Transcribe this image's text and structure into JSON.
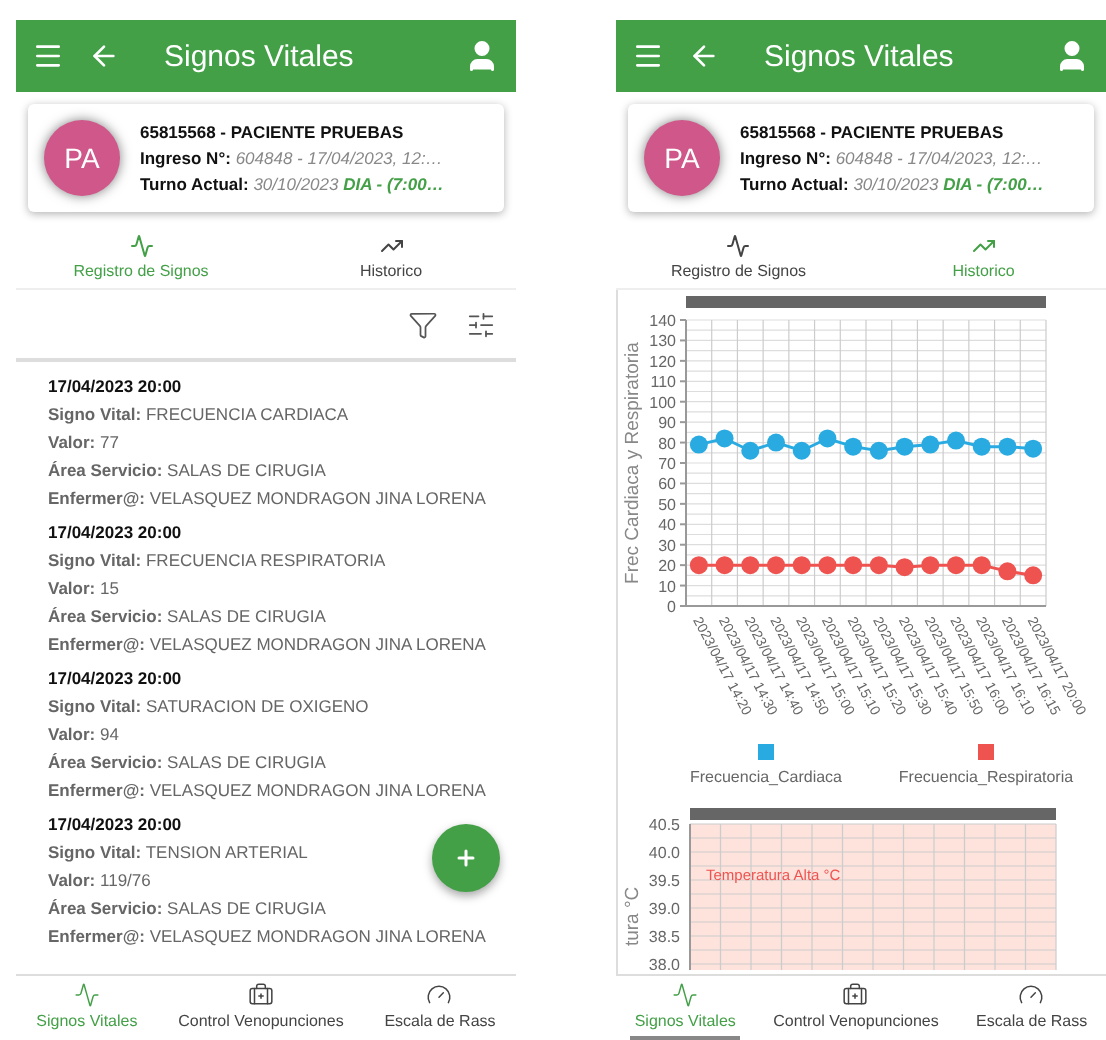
{
  "screens": [
    {
      "header": {
        "title": "Signos Vitales"
      },
      "patient": {
        "initials": "PA",
        "name": "65815568 - PACIENTE PRUEBAS",
        "admission_label": "Ingreso N°:",
        "admission_value": "604848 - 17/04/2023, 12:…",
        "shift_label": "Turno Actual:",
        "shift_date": "30/10/2023",
        "shift_name": "DIA - (7:00…"
      },
      "tabs": [
        {
          "label": "Registro de Signos",
          "selected": true
        },
        {
          "label": "Historico",
          "selected": false
        }
      ],
      "records": [
        {
          "datetime": "17/04/2023 20:00",
          "fields": [
            {
              "label": "Signo Vital:",
              "value": "FRECUENCIA CARDIACA"
            },
            {
              "label": "Valor:",
              "value": "77"
            },
            {
              "label": "Área Servicio:",
              "value": "SALAS DE CIRUGIA"
            },
            {
              "label": "Enfermer@:",
              "value": "VELASQUEZ MONDRAGON JINA LORENA"
            }
          ]
        },
        {
          "datetime": "17/04/2023 20:00",
          "fields": [
            {
              "label": "Signo Vital:",
              "value": "FRECUENCIA RESPIRATORIA"
            },
            {
              "label": "Valor:",
              "value": "15"
            },
            {
              "label": "Área Servicio:",
              "value": "SALAS DE CIRUGIA"
            },
            {
              "label": "Enfermer@:",
              "value": "VELASQUEZ MONDRAGON JINA LORENA"
            }
          ]
        },
        {
          "datetime": "17/04/2023 20:00",
          "fields": [
            {
              "label": "Signo Vital:",
              "value": "SATURACION DE OXIGENO"
            },
            {
              "label": "Valor:",
              "value": "94"
            },
            {
              "label": "Área Servicio:",
              "value": "SALAS DE CIRUGIA"
            },
            {
              "label": "Enfermer@:",
              "value": "VELASQUEZ MONDRAGON JINA LORENA"
            }
          ]
        },
        {
          "datetime": "17/04/2023 20:00",
          "fields": [
            {
              "label": "Signo Vital:",
              "value": "TENSION ARTERIAL"
            },
            {
              "label": "Valor:",
              "value": "119/76"
            },
            {
              "label": "Área Servicio:",
              "value": "SALAS DE CIRUGIA"
            },
            {
              "label": "Enfermer@:",
              "value": "VELASQUEZ MONDRAGON JINA LORENA"
            }
          ]
        }
      ],
      "bottom_nav": [
        {
          "label": "Signos Vitales",
          "selected": true
        },
        {
          "label": "Control Venopunciones",
          "selected": false
        },
        {
          "label": "Escala de Rass",
          "selected": false
        }
      ]
    },
    {
      "header": {
        "title": "Signos Vitales"
      },
      "patient": {
        "initials": "PA",
        "name": "65815568 - PACIENTE PRUEBAS",
        "admission_label": "Ingreso N°:",
        "admission_value": "604848 - 17/04/2023, 12:…",
        "shift_label": "Turno Actual:",
        "shift_date": "30/10/2023",
        "shift_name": "DIA - (7:00…"
      },
      "tabs": [
        {
          "label": "Registro de Signos",
          "selected": false
        },
        {
          "label": "Historico",
          "selected": true
        }
      ],
      "charts": [
        {
          "chart_data": {
            "type": "line",
            "ylabel": "Frec Cardiaca y Respiratoria",
            "grid": true,
            "legend": true,
            "categories": [
              "2023/04/17 14:20",
              "2023/04/17 14:30",
              "2023/04/17 14:40",
              "2023/04/17 14:50",
              "2023/04/17 15:00",
              "2023/04/17 15:10",
              "2023/04/17 15:20",
              "2023/04/17 15:30",
              "2023/04/17 15:40",
              "2023/04/17 15:50",
              "2023/04/17 16:00",
              "2023/04/17 16:10",
              "2023/04/17 16:15",
              "2023/04/17 20:00"
            ],
            "series": [
              {
                "name": "Frecuencia_Cardiaca",
                "color": "#29abe2",
                "marker": "circle",
                "values": [
                  79,
                  82,
                  76,
                  80,
                  76,
                  82,
                  78,
                  76,
                  78,
                  79,
                  81,
                  78,
                  78,
                  77
                ]
              },
              {
                "name": "Frecuencia_Respiratoria",
                "color": "#ef5350",
                "marker": "circle",
                "values": [
                  20,
                  20,
                  20,
                  20,
                  20,
                  20,
                  20,
                  20,
                  19,
                  20,
                  20,
                  20,
                  17,
                  15
                ]
              }
            ],
            "ylim": [
              0,
              140
            ],
            "yticks": [
              0,
              10,
              20,
              30,
              40,
              50,
              60,
              70,
              80,
              90,
              100,
              110,
              120,
              130,
              140
            ]
          }
        },
        {
          "chart_data": {
            "type": "line",
            "ylabel": "tura °C",
            "grid": true,
            "categories": [
              null,
              null,
              null,
              null,
              null,
              null,
              null,
              null,
              null,
              null,
              null,
              null
            ],
            "ylim": [
              38,
              40.5
            ],
            "yticks": [
              {
                "value": 38,
                "label": "38.0"
              },
              {
                "value": 38.5,
                "label": "38.5"
              },
              {
                "value": 39,
                "label": "39.0"
              },
              {
                "value": 39.5,
                "label": "39.5"
              },
              {
                "value": 40,
                "label": "40.0"
              },
              {
                "value": 40.5,
                "label": "40.5"
              }
            ],
            "annotations": [
              {
                "text": "Temperatura Alta °C"
              }
            ]
          }
        }
      ],
      "bottom_nav": [
        {
          "label": "Signos Vitales",
          "selected": true
        },
        {
          "label": "Control Venopunciones",
          "selected": false
        },
        {
          "label": "Escala de Rass",
          "selected": false
        }
      ]
    }
  ]
}
